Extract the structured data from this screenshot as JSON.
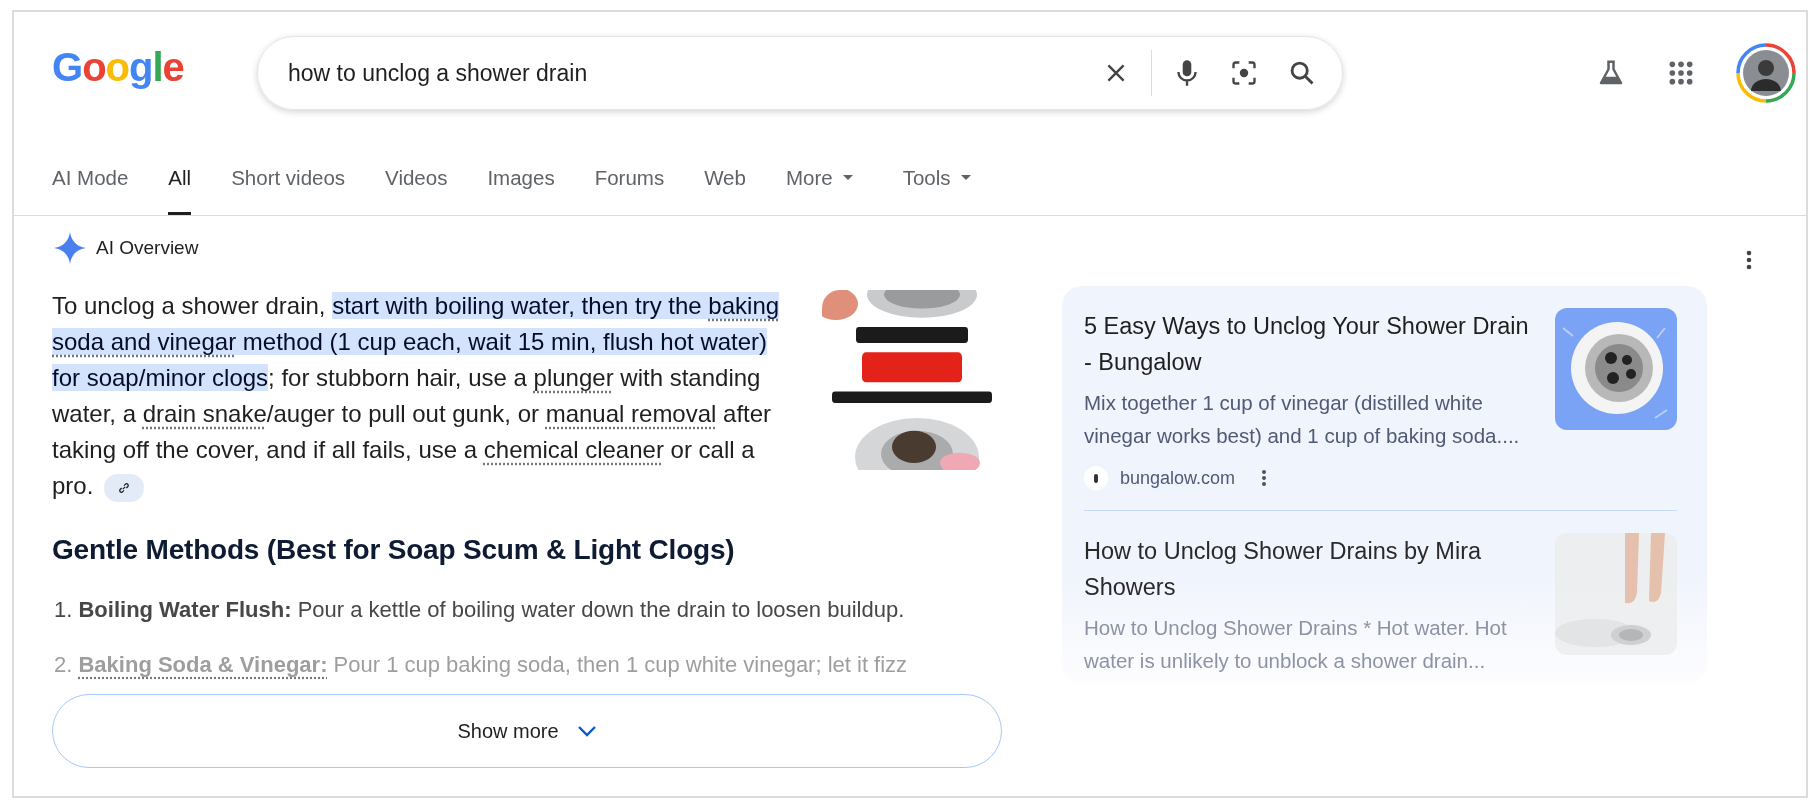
{
  "logo": {
    "text": "Google"
  },
  "search": {
    "value": "how to unclog a shower drain"
  },
  "tabs": [
    {
      "label": "AI Mode",
      "selected": false,
      "dropdown": false
    },
    {
      "label": "All",
      "selected": true,
      "dropdown": false
    },
    {
      "label": "Short videos",
      "selected": false,
      "dropdown": false
    },
    {
      "label": "Videos",
      "selected": false,
      "dropdown": false
    },
    {
      "label": "Images",
      "selected": false,
      "dropdown": false
    },
    {
      "label": "Forums",
      "selected": false,
      "dropdown": false
    },
    {
      "label": "Web",
      "selected": false,
      "dropdown": false
    },
    {
      "label": "More",
      "selected": false,
      "dropdown": true
    },
    {
      "label": "Tools",
      "selected": false,
      "dropdown": true
    }
  ],
  "ai_overview": {
    "title": "AI Overview",
    "summary": [
      {
        "text": "To unclog a shower drain, ",
        "highlight": false,
        "underline": false
      },
      {
        "text": "start with boiling water, then try the ",
        "highlight": true,
        "underline": false
      },
      {
        "text": "baking soda and vinegar",
        "highlight": true,
        "underline": true
      },
      {
        "text": " method (1 cup each, wait 15 min, flush hot water) for soap/minor clogs",
        "highlight": true,
        "underline": false
      },
      {
        "text": "; for stubborn hair, use a ",
        "highlight": false,
        "underline": false
      },
      {
        "text": "plunger",
        "highlight": false,
        "underline": true
      },
      {
        "text": " with standing water, a ",
        "highlight": false,
        "underline": false
      },
      {
        "text": "drain snake",
        "highlight": false,
        "underline": true
      },
      {
        "text": "/auger to pull out gunk, or ",
        "highlight": false,
        "underline": false
      },
      {
        "text": "manual removal",
        "highlight": false,
        "underline": true
      },
      {
        "text": " after taking off the cover, and if all fails, use a ",
        "highlight": false,
        "underline": false
      },
      {
        "text": "chemical cleaner",
        "highlight": false,
        "underline": true
      },
      {
        "text": " or call a pro.",
        "highlight": false,
        "underline": false
      }
    ],
    "heading": "Gentle Methods (Best for Soap Scum & Light Clogs)",
    "steps": [
      {
        "number": "1.",
        "term": "Boiling Water Flush:",
        "linked": false,
        "text": "Pour a kettle of boiling water down the drain to loosen buildup."
      },
      {
        "number": "2.",
        "term": "Baking Soda & Vinegar:",
        "linked": true,
        "text": "Pour 1 cup baking soda, then 1 cup white vinegar; let it fizz"
      }
    ],
    "show_more": "Show more"
  },
  "sources": [
    {
      "title": "5 Easy Ways to Unclog Your Shower Drain - Bungalow",
      "snippet": "Mix together 1 cup of vinegar (distilled white vinegar works best) and 1 cup of baking soda....",
      "site": "bungalow.com"
    },
    {
      "title": "How to Unclog Shower Drains by Mira Showers",
      "snippet": "How to Unclog Shower Drains * Hot water. Hot water is unlikely to unblock a shower drain..."
    }
  ]
}
